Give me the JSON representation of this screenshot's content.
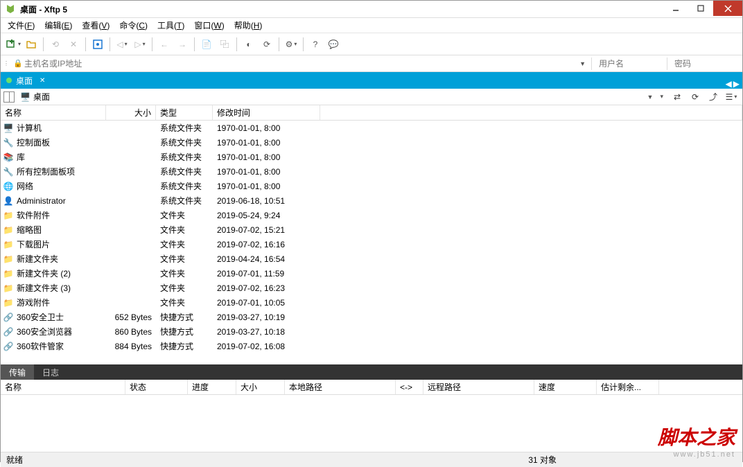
{
  "window": {
    "title": "桌面    - Xftp 5"
  },
  "menu": [
    {
      "label": "文件",
      "key": "F"
    },
    {
      "label": "编辑",
      "key": "E"
    },
    {
      "label": "查看",
      "key": "V"
    },
    {
      "label": "命令",
      "key": "C"
    },
    {
      "label": "工具",
      "key": "T"
    },
    {
      "label": "窗口",
      "key": "W"
    },
    {
      "label": "帮助",
      "key": "H"
    }
  ],
  "address": {
    "placeholder": "主机名或IP地址",
    "user_placeholder": "用户名",
    "pass_placeholder": "密码"
  },
  "tab": {
    "label": "桌面"
  },
  "path": {
    "label": "桌面"
  },
  "columns": {
    "name": "名称",
    "size": "大小",
    "type": "类型",
    "date": "修改时间"
  },
  "rows": [
    {
      "icon": "computer",
      "name": "计算机",
      "size": "",
      "type": "系统文件夹",
      "date": "1970-01-01, 8:00"
    },
    {
      "icon": "panel",
      "name": "控制面板",
      "size": "",
      "type": "系统文件夹",
      "date": "1970-01-01, 8:00"
    },
    {
      "icon": "lib",
      "name": "库",
      "size": "",
      "type": "系统文件夹",
      "date": "1970-01-01, 8:00"
    },
    {
      "icon": "panel",
      "name": "所有控制面板项",
      "size": "",
      "type": "系统文件夹",
      "date": "1970-01-01, 8:00"
    },
    {
      "icon": "net",
      "name": "网络",
      "size": "",
      "type": "系统文件夹",
      "date": "1970-01-01, 8:00"
    },
    {
      "icon": "user",
      "name": "Administrator",
      "size": "",
      "type": "系统文件夹",
      "date": "2019-06-18, 10:51"
    },
    {
      "icon": "folder",
      "name": "软件附件",
      "size": "",
      "type": "文件夹",
      "date": "2019-05-24, 9:24"
    },
    {
      "icon": "folder",
      "name": "缩略图",
      "size": "",
      "type": "文件夹",
      "date": "2019-07-02, 15:21"
    },
    {
      "icon": "folder",
      "name": "下载图片",
      "size": "",
      "type": "文件夹",
      "date": "2019-07-02, 16:16"
    },
    {
      "icon": "folder",
      "name": "新建文件夹",
      "size": "",
      "type": "文件夹",
      "date": "2019-04-24, 16:54"
    },
    {
      "icon": "folder",
      "name": "新建文件夹 (2)",
      "size": "",
      "type": "文件夹",
      "date": "2019-07-01, 11:59"
    },
    {
      "icon": "folder",
      "name": "新建文件夹 (3)",
      "size": "",
      "type": "文件夹",
      "date": "2019-07-02, 16:23"
    },
    {
      "icon": "folder",
      "name": "游戏附件",
      "size": "",
      "type": "文件夹",
      "date": "2019-07-01, 10:05"
    },
    {
      "icon": "shortcut",
      "name": "360安全卫士",
      "size": "652 Bytes",
      "type": "快捷方式",
      "date": "2019-03-27, 10:19"
    },
    {
      "icon": "shortcut",
      "name": "360安全浏览器",
      "size": "860 Bytes",
      "type": "快捷方式",
      "date": "2019-03-27, 10:18"
    },
    {
      "icon": "shortcut",
      "name": "360软件管家",
      "size": "884 Bytes",
      "type": "快捷方式",
      "date": "2019-07-02, 16:08"
    }
  ],
  "transfer": {
    "tabs": [
      "传输",
      "日志"
    ],
    "columns": [
      "名称",
      "状态",
      "进度",
      "大小",
      "本地路径",
      "<->",
      "远程路径",
      "速度",
      "估计剩余..."
    ]
  },
  "status": {
    "ready": "就绪",
    "count": "31 对象"
  },
  "watermark": {
    "main": "脚本之家",
    "sub": "www.jb51.net"
  }
}
